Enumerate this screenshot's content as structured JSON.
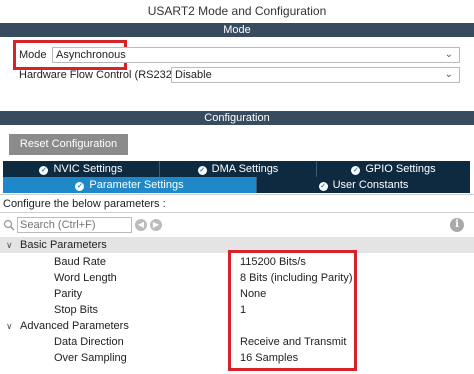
{
  "window": {
    "title": "USART2 Mode and Configuration"
  },
  "mode_section": {
    "header": "Mode",
    "mode": {
      "label": "Mode",
      "value": "Asynchronous"
    },
    "flow": {
      "label": "Hardware Flow Control (RS232)",
      "value": "Disable"
    }
  },
  "config_section": {
    "header": "Configuration",
    "reset_button": "Reset Configuration",
    "tabs_row1": [
      "NVIC Settings",
      "DMA Settings",
      "GPIO Settings"
    ],
    "tabs_row2": [
      "Parameter Settings",
      "User Constants"
    ],
    "hint": "Configure the below parameters :",
    "search_placeholder": "Search (Ctrl+F)"
  },
  "params": {
    "basic": {
      "label": "Basic Parameters",
      "items": [
        {
          "name": "Baud Rate",
          "value": "115200 Bits/s"
        },
        {
          "name": "Word Length",
          "value": "8 Bits (including Parity)"
        },
        {
          "name": "Parity",
          "value": "None"
        },
        {
          "name": "Stop Bits",
          "value": "1"
        }
      ]
    },
    "advanced": {
      "label": "Advanced Parameters",
      "items": [
        {
          "name": "Data Direction",
          "value": "Receive and Transmit"
        },
        {
          "name": "Over Sampling",
          "value": "16 Samples"
        }
      ]
    }
  },
  "colors": {
    "header_bar": "#384c5f",
    "tab_dark": "#0e2a40",
    "tab_active": "#1e88c8",
    "highlight": "#d8222a"
  }
}
